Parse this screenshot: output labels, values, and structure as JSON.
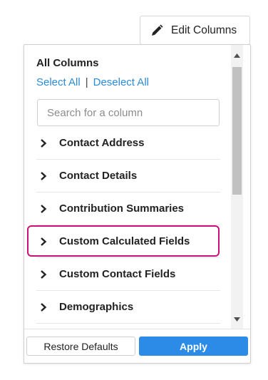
{
  "edit_columns": {
    "label": "Edit Columns",
    "icon": "pencil-icon"
  },
  "panel": {
    "title": "All Columns",
    "select_all": "Select All",
    "separator": "|",
    "deselect_all": "Deselect All",
    "search": {
      "placeholder": "Search for a column",
      "value": ""
    },
    "groups": [
      {
        "label": "Contact Address",
        "icon": "chevron-right-icon"
      },
      {
        "label": "Contact Details",
        "icon": "chevron-right-icon"
      },
      {
        "label": "Contribution Summaries",
        "icon": "chevron-right-icon"
      },
      {
        "label": "Custom Calculated Fields",
        "icon": "chevron-right-icon",
        "highlighted": true
      },
      {
        "label": "Custom Contact Fields",
        "icon": "chevron-right-icon"
      },
      {
        "label": "Demographics",
        "icon": "chevron-right-icon"
      }
    ],
    "scrollbar": {
      "up_icon": "triangle-up-icon",
      "down_icon": "triangle-down-icon"
    },
    "footer": {
      "restore_label": "Restore Defaults",
      "apply_label": "Apply"
    }
  },
  "colors": {
    "link": "#2a8bd6",
    "apply": "#2b8be6",
    "highlight": "#c8127a"
  }
}
